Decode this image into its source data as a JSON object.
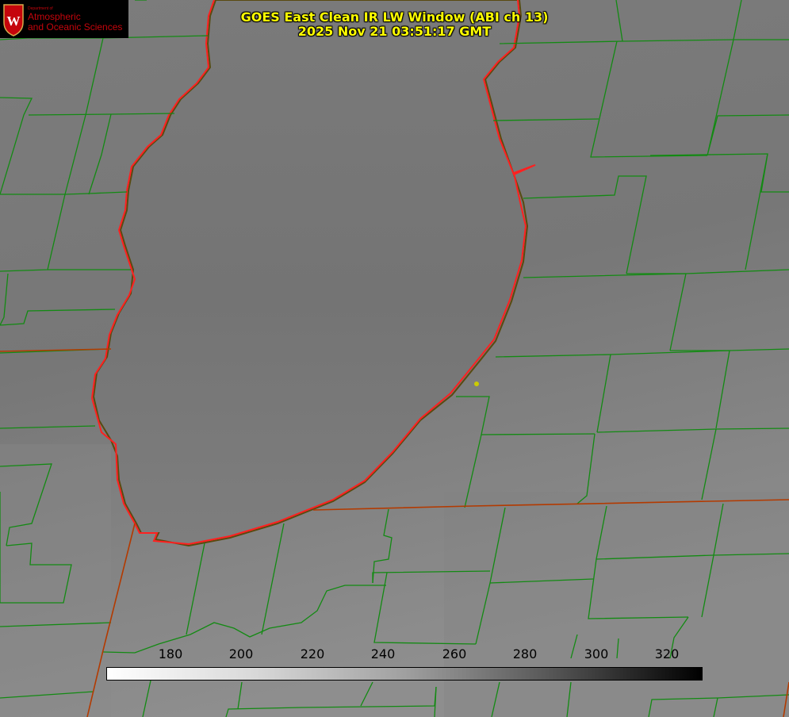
{
  "header": {
    "title_line1": "GOES East Clean IR LW Window (ABI ch 13)",
    "title_line2": "2025 Nov 21 03:51:17 GMT"
  },
  "logo": {
    "line_dept": "Department of",
    "line1": "Atmospheric",
    "line2": "and Oceanic Sciences",
    "crest_letter": "W"
  },
  "colorbar": {
    "ticks": [
      "180",
      "200",
      "220",
      "240",
      "260",
      "280",
      "300",
      "320"
    ],
    "gradient": [
      "#ffffff",
      "#000000"
    ]
  },
  "colors": {
    "county_lines": "#138a13",
    "state_lines": "#b33a00",
    "coastline": "#ff2020",
    "background_gray": "#7a7a7a",
    "title": "#ffff00",
    "marker": "#cccc00"
  }
}
